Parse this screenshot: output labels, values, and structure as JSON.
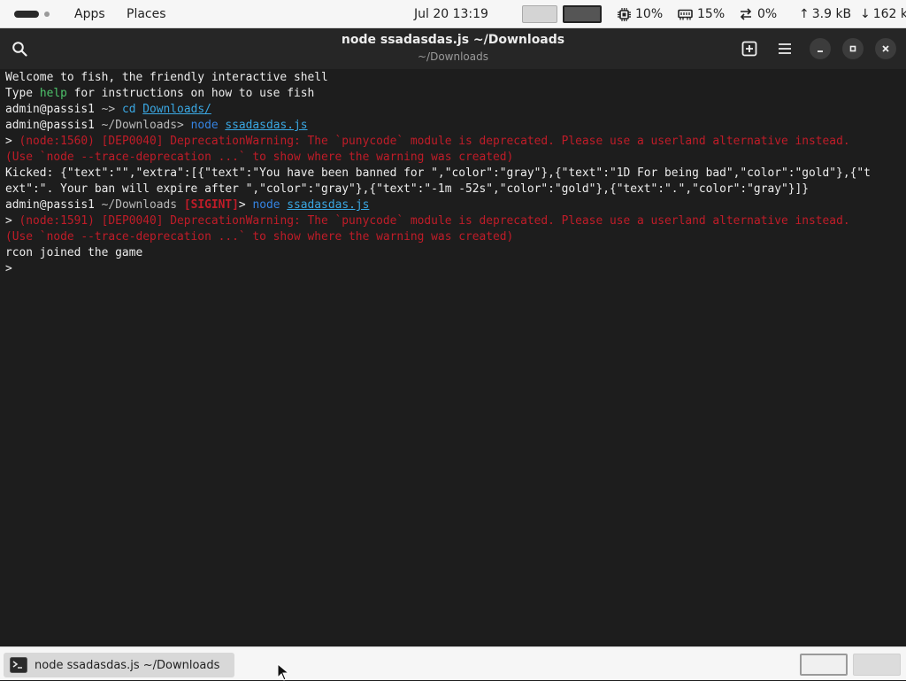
{
  "topbar": {
    "apps": "Apps",
    "places": "Places",
    "clock": "Jul 20  13:19",
    "cpu": "10%",
    "memory": "15%",
    "swap": "0%",
    "net_up": "3.9 kB",
    "net_down": "162 k"
  },
  "window": {
    "title": "node ssadasdas.js ~/Downloads",
    "subtitle": "~/Downloads"
  },
  "terminal": {
    "l1": "Welcome to fish, the friendly interactive shell",
    "l2": {
      "a": "Type ",
      "b": "help",
      "c": " for instructions on how to use fish"
    },
    "l3": {
      "user": "admin@passis1",
      "path": " ~> ",
      "cmd": "cd ",
      "arg": "Downloads/"
    },
    "l4": {
      "user": "admin@passis1",
      "path": " ~/Downloads> ",
      "cmd": "node ",
      "arg": "ssadasdas.js"
    },
    "l5": {
      "gt": "> ",
      "text": "(node:1560) [DEP0040] DeprecationWarning: The `punycode` module is deprecated. Please use a userland alternative instead."
    },
    "l6": "(Use `node --trace-deprecation ...` to show where the warning was created)",
    "l7": "Kicked: {\"text\":\"\",\"extra\":[{\"text\":\"You have been banned for \",\"color\":\"gray\"},{\"text\":\"1D For being bad\",\"color\":\"gold\"},{\"t",
    "l8": "ext\":\". Your ban will expire after \",\"color\":\"gray\"},{\"text\":\"-1m -52s\",\"color\":\"gold\"},{\"text\":\".\",\"color\":\"gray\"}]}",
    "l9": {
      "user": "admin@passis1",
      "path": " ~/Downloads ",
      "sig": "[SIGINT]",
      "gt": "> ",
      "cmd": "node ",
      "arg": "ssadasdas.js"
    },
    "l10": {
      "gt": "> ",
      "text": "(node:1591) [DEP0040] DeprecationWarning: The `punycode` module is deprecated. Please use a userland alternative instead."
    },
    "l11": "(Use `node --trace-deprecation ...` to show where the warning was created)",
    "l12": "rcon joined the game",
    "l13": ">"
  },
  "taskbar": {
    "task_label": "node ssadasdas.js ~/Downloads"
  },
  "icons": {
    "search": "search-icon",
    "new_tab": "new-tab-icon",
    "menu": "hamburger-menu-icon",
    "minimize": "minimize-icon",
    "maximize": "maximize-icon",
    "close": "close-icon",
    "cpu": "cpu-chip-icon",
    "memory": "memory-icon",
    "swap": "swap-arrows-icon",
    "terminal": "terminal-icon"
  }
}
